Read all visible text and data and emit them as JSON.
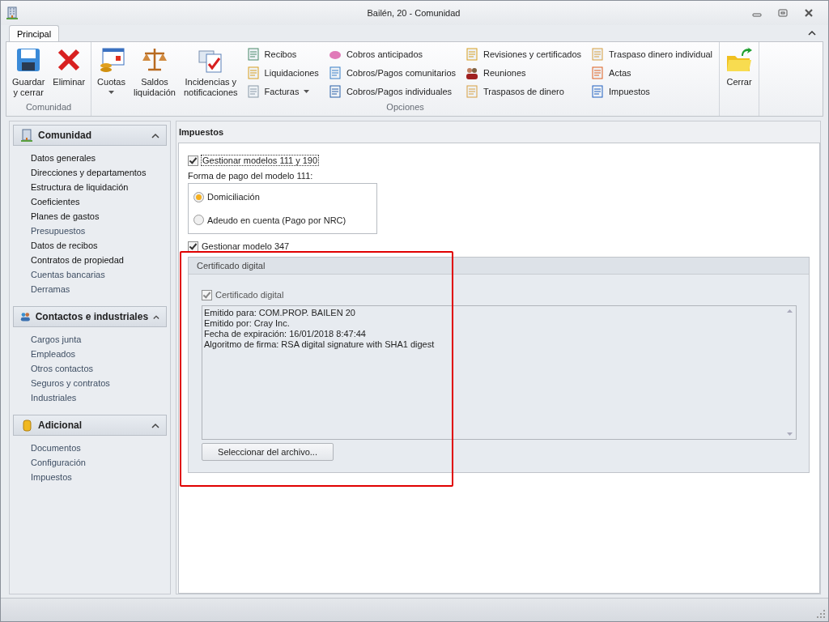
{
  "window": {
    "title": "Bailén, 20 - Comunidad"
  },
  "ribbon": {
    "tabs": [
      {
        "label": "Principal",
        "selected": true
      }
    ],
    "groups": [
      {
        "label": "Comunidad",
        "large": [
          {
            "label": "Guardar\ny cerrar",
            "dropdown": false
          },
          {
            "label": "Eliminar",
            "dropdown": false
          }
        ]
      },
      {
        "label": "Opciones",
        "large": [
          {
            "label": "Cuotas",
            "dropdown": true
          },
          {
            "label": "Saldos\nliquidación",
            "dropdown": false
          },
          {
            "label": "Incidencias y\nnotificaciones",
            "dropdown": false
          }
        ],
        "columns": [
          [
            {
              "label": "Recibos",
              "dropdown": false
            },
            {
              "label": "Liquidaciones",
              "dropdown": false
            },
            {
              "label": "Facturas",
              "dropdown": true
            }
          ],
          [
            {
              "label": "Cobros anticipados",
              "dropdown": false
            },
            {
              "label": "Cobros/Pagos comunitarios",
              "dropdown": false
            },
            {
              "label": "Cobros/Pagos individuales",
              "dropdown": false
            }
          ],
          [
            {
              "label": "Revisiones y certificados",
              "dropdown": false
            },
            {
              "label": "Reuniones",
              "dropdown": false
            },
            {
              "label": "Traspasos de dinero",
              "dropdown": false
            }
          ],
          [
            {
              "label": "Traspaso dinero individual",
              "dropdown": false
            },
            {
              "label": "Actas",
              "dropdown": false
            },
            {
              "label": "Impuestos",
              "dropdown": false
            }
          ]
        ]
      },
      {
        "large": [
          {
            "label": "Cerrar",
            "dropdown": false
          }
        ]
      }
    ]
  },
  "sidebar": {
    "sections": [
      {
        "title": "Comunidad",
        "expanded": true,
        "items": [
          {
            "label": "Datos generales",
            "active": true
          },
          {
            "label": "Direcciones y departamentos",
            "active": true
          },
          {
            "label": "Estructura de liquidación",
            "active": true
          },
          {
            "label": "Coeficientes",
            "active": true
          },
          {
            "label": "Planes de gastos",
            "active": true
          },
          {
            "label": "Presupuestos",
            "active": false
          },
          {
            "label": "Datos de recibos",
            "active": true
          },
          {
            "label": "Contratos de propiedad",
            "active": true
          },
          {
            "label": "Cuentas bancarias",
            "active": false
          },
          {
            "label": "Derramas",
            "active": false
          }
        ]
      },
      {
        "title": "Contactos e industriales",
        "expanded": true,
        "items": [
          {
            "label": "Cargos junta",
            "active": false
          },
          {
            "label": "Empleados",
            "active": false
          },
          {
            "label": "Otros contactos",
            "active": false
          },
          {
            "label": "Seguros y contratos",
            "active": false
          },
          {
            "label": "Industriales",
            "active": false
          }
        ]
      },
      {
        "title": "Adicional",
        "expanded": true,
        "items": [
          {
            "label": "Documentos",
            "active": false
          },
          {
            "label": "Configuración",
            "active": false
          },
          {
            "label": "Impuestos",
            "active": false
          }
        ]
      }
    ]
  },
  "panel": {
    "title": "Impuestos",
    "check_111_190": {
      "label": "Gestionar modelos 111 y 190",
      "checked": true
    },
    "payment_label": "Forma de pago del modelo 111:",
    "payment_options": [
      {
        "label": "Domiciliación",
        "selected": true
      },
      {
        "label": "Adeudo en cuenta (Pago por NRC)",
        "selected": false
      }
    ],
    "check_347": {
      "label": "Gestionar modelo 347",
      "checked": true
    },
    "certificate_group": {
      "title": "Certificado digital",
      "checkbox": {
        "label": "Certificado digital",
        "checked": true,
        "disabled": true
      },
      "details": [
        "Emitido para: COM.PROP. BAILEN 20",
        "Emitido por: Cray Inc.",
        "Fecha de expiración: 16/01/2018 8:47:44",
        "Algoritmo de firma: RSA digital signature with SHA1 digest"
      ],
      "button": "Seleccionar del archivo..."
    }
  }
}
